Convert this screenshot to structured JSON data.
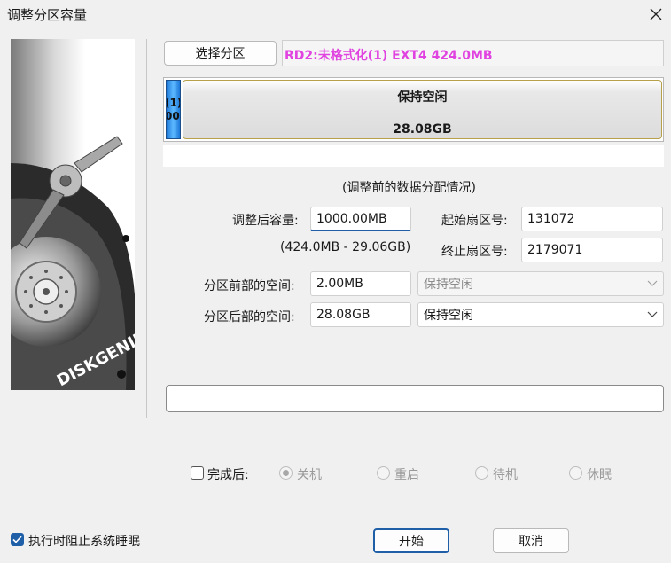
{
  "window": {
    "title": "调整分区容量"
  },
  "partition": {
    "select_button": "选择分区",
    "info": "RD2:未格式化(1) EXT4 424.0MB"
  },
  "disk_map": {
    "used_label_1": "(1)",
    "used_label_2": "00",
    "free_title": "保持空闲",
    "free_size": "28.08GB",
    "used_color": "#1e78d8"
  },
  "note": "(调整前的数据分配情况)",
  "form": {
    "size_label": "调整后容量:",
    "size_value": "1000.00MB",
    "range": "(424.0MB - 29.06GB)",
    "start_sector_label": "起始扇区号:",
    "start_sector_value": "131072",
    "end_sector_label": "终止扇区号:",
    "end_sector_value": "2179071",
    "front_label": "分区前部的空间:",
    "front_value": "2.00MB",
    "front_option": "保持空闲",
    "back_label": "分区后部的空间:",
    "back_value": "28.08GB",
    "back_option": "保持空闲"
  },
  "progress": {
    "percent": 0
  },
  "completion": {
    "label": "完成后:",
    "checked": false,
    "options": [
      {
        "label": "关机",
        "selected": true
      },
      {
        "label": "重启",
        "selected": false
      },
      {
        "label": "待机",
        "selected": false
      },
      {
        "label": "休眠",
        "selected": false
      }
    ]
  },
  "footer": {
    "prevent_sleep_label": "执行时阻止系统睡眠",
    "prevent_sleep_checked": true,
    "start_button": "开始",
    "cancel_button": "取消"
  },
  "logo": {
    "text": "DISKGENIUS"
  },
  "colors": {
    "accent": "#1f5fa8",
    "partition_text": "#e043e0"
  }
}
